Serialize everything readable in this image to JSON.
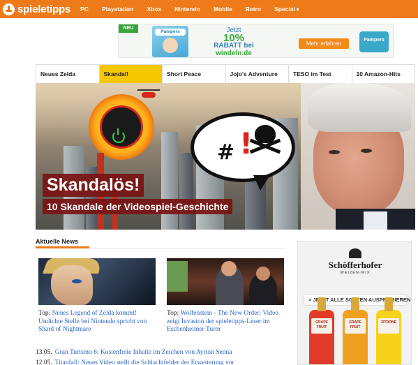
{
  "site": {
    "logo_text": "spieletipps"
  },
  "nav": {
    "items": [
      "PC",
      "Playstation",
      "Xbox",
      "Nintendo",
      "Mobile",
      "Retro",
      "Special"
    ]
  },
  "ad_banner": {
    "badge": "NEU",
    "product": "Pampers",
    "line1": "Jetzt",
    "line2": "10%",
    "line3": "RABATT bei",
    "line4": "windeln.de",
    "cta": "Mehr erfahren",
    "brand": "Pampers"
  },
  "teaser_tabs": [
    {
      "label": "Neues Zelda",
      "active": false
    },
    {
      "label": "Skandal!",
      "active": true
    },
    {
      "label": "Short Peace",
      "active": false
    },
    {
      "label": "Jojo's Adventure",
      "active": false
    },
    {
      "label": "TESO im Test",
      "active": false
    },
    {
      "label": "10 Amazon-Hits",
      "active": false
    }
  ],
  "hero": {
    "title": "Skandalös!",
    "subtitle": "10 Skandale der Videospiel-Geschichte"
  },
  "news": {
    "section_title": "Aktuelle News",
    "cards": [
      {
        "prefix": "Top:",
        "title": "Neues Legend of Zelda kommt!",
        "rest": "Undichte Stelle bei Nintendo spricht von Shard of Nightmare"
      },
      {
        "prefix": "Top:",
        "title": "Wolfenstein - The New Order:",
        "rest": "Video zeigt Invasion der spieletipps-Leser im Eschenheimer Turm"
      }
    ],
    "list": [
      {
        "date": "13.05.",
        "title": "Gran Turismo 6: Kostenfreie Inhalte im Zeichen von Ayrton Senna"
      },
      {
        "date": "12.05.",
        "title": "Titanfall: Neues Video stellt die Schlachtfelder der Erweiterung vor"
      }
    ]
  },
  "side_ad": {
    "brand": "Schöfferhofer",
    "sub": "WEIZEN-MIX",
    "cta": "> JETZT ALLE SORTEN AUSPROBIEREN!",
    "bottles": [
      {
        "label": "GRAPE FRUIT",
        "color": "#e23b2a"
      },
      {
        "label": "GRAPE FRUIT",
        "color": "#f0a020"
      },
      {
        "label": "ZITRONE",
        "color": "#f6d21a"
      }
    ]
  },
  "colors": {
    "brand_orange": "#ef7a1a",
    "active_tab": "#f6c700",
    "link_blue": "#2a64c5"
  }
}
